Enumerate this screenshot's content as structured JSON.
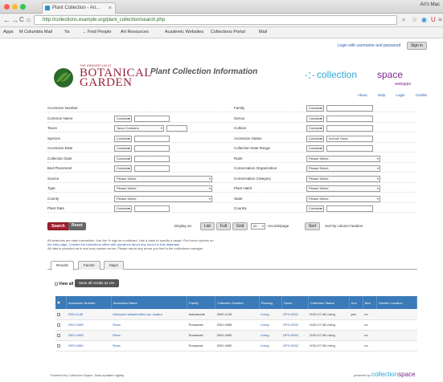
{
  "browser": {
    "tab_title": "Plant Collection - Ari...",
    "tab_close": "×",
    "user": "Ari's Mac",
    "url": "http://collections.example.org/plant_collection/search.php",
    "nav": {
      "back": "←",
      "forward": "→",
      "reload": "C",
      "home": "⌂"
    },
    "bookmarks": [
      "Apps",
      "M  Columbia Mail",
      "Ya",
      "→ Find People",
      "Art Resources",
      "Academic Websites",
      "Collections Portal",
      "Mail"
    ]
  },
  "header": {
    "login_text": "Login with username and password",
    "signin_label": "Sign in",
    "org_small": "THE ARBORETUM AT",
    "org_line1": "BOTANICAL",
    "org_line2": "GARDEN",
    "title": "Plant Collection Information",
    "cs_mark": "·:·",
    "cs_word1": "collection",
    "cs_word2": "space",
    "cs_sub": "webapps",
    "links": [
      "About",
      "Help",
      "Login",
      "Credits"
    ]
  },
  "form": {
    "rows": [
      {
        "l_label": "Accession Number",
        "l_sel": "",
        "l_input": false,
        "r_label": "Family",
        "r_sel": "Contains",
        "r_input": ""
      },
      {
        "l_label": "Common Name",
        "l_sel": "Contains",
        "l_input": true,
        "r_label": "Genus",
        "r_sel": "Contains",
        "r_input": ""
      },
      {
        "l_label": "Taxon",
        "l_sel": "Taxon Contains",
        "l_input": true,
        "r_label": "Cultivar",
        "r_sel": "Contains",
        "r_input": ""
      },
      {
        "l_label": "Species",
        "l_sel": "Contains",
        "l_input": true,
        "r_label": "Accession Status",
        "r_sel": "Contains",
        "r_input": "Include Dead"
      },
      {
        "l_label": "Accession Date",
        "l_sel": "Contains",
        "l_input": true,
        "r_label": "Collection Date Range",
        "r_sel": "Contains",
        "r_input": ""
      },
      {
        "l_label": "Collection Date",
        "l_sel": "Contains",
        "l_input": true,
        "r_label": "Rank",
        "r_sel": "Please Select",
        "r_input": ""
      },
      {
        "l_label": "Bed Placement",
        "l_sel": "Contains",
        "l_input": true,
        "r_label": "Conservation Organization",
        "r_sel": "Please Select",
        "r_input": ""
      },
      {
        "l_label": "Source",
        "l_sel": "Please Select",
        "l_input": false,
        "r_label": "Conservation Category",
        "r_sel": "Please Select",
        "r_input": ""
      },
      {
        "l_label": "Type",
        "l_sel": "Please Select",
        "l_input": false,
        "r_label": "Plant Habit",
        "r_sel": "Please Select",
        "r_input": ""
      },
      {
        "l_label": "County",
        "l_sel": "Please Select",
        "l_input": false,
        "r_label": "State",
        "r_sel": "Please Select",
        "r_input": ""
      },
      {
        "l_label": "Plant Date",
        "l_sel": "Contains",
        "l_input": true,
        "r_label": "Country",
        "r_sel": "Contains",
        "r_input": ""
      }
    ]
  },
  "actions": {
    "search": "Search",
    "reset": "Reset",
    "display_as": "Display as:",
    "list": "List",
    "full": "Full",
    "grid": "Grid",
    "count_sel": "50",
    "count_text": "records/page",
    "sort": "Sort",
    "sort_hint": "Sort by column headers"
  },
  "notes": [
    "All searches are case insensitive. Use the % sign as a wildcard. Use a dash to specify a range. Find more options on",
    "the help page. Contact the collections office with questions about any record in this database.",
    "All data is provided as is and may contain errors. Please report any errors you find to the collections manager."
  ],
  "result_tabs": [
    "Results",
    "Facets",
    "Maps"
  ],
  "results": {
    "view_all": "View all",
    "save_button": "Save all results as csv",
    "columns": [
      "Accession Number",
      "Accession Name",
      "Family",
      "Collection Number",
      "Planting",
      "Taxon",
      "Collection Status",
      "Acc",
      "Bed",
      "Garden Location"
    ],
    "rows": [
      [
        "2000.1145",
        "Heliopsis helianthoides var. scabra",
        "Asteraceae",
        "2000.1145",
        "Living",
        "DPO-0001",
        "2001.07.06 Living",
        "yes",
        "no",
        ""
      ],
      [
        "2001.0458",
        "Rosa",
        "Rosaceae",
        "2001.0458",
        "Living",
        "DPO-0002",
        "2001.07.06 Living",
        "",
        "no",
        ""
      ],
      [
        "2001.0459",
        "Rosa",
        "Rosaceae",
        "2001.0459",
        "Living",
        "DPO-0002",
        "2001.07.06 Living",
        "",
        "no",
        ""
      ],
      [
        "2001.0460",
        "Rosa",
        "Rosaceae",
        "2001.0460",
        "Living",
        "DPO-0002",
        "2001.07.06 Living",
        "",
        "no",
        ""
      ]
    ]
  },
  "footer": {
    "left": "Powered by Collection Space. Data updated nightly.",
    "right_label": "powered by",
    "cs1": "collection",
    "cs2": "space"
  },
  "colors": {
    "brand_maroon": "#9a2040",
    "cs_blue": "#2fa8d8",
    "cs_purple": "#7a2a8a",
    "table_header": "#3a7ab8",
    "search_button": "#a02030"
  }
}
